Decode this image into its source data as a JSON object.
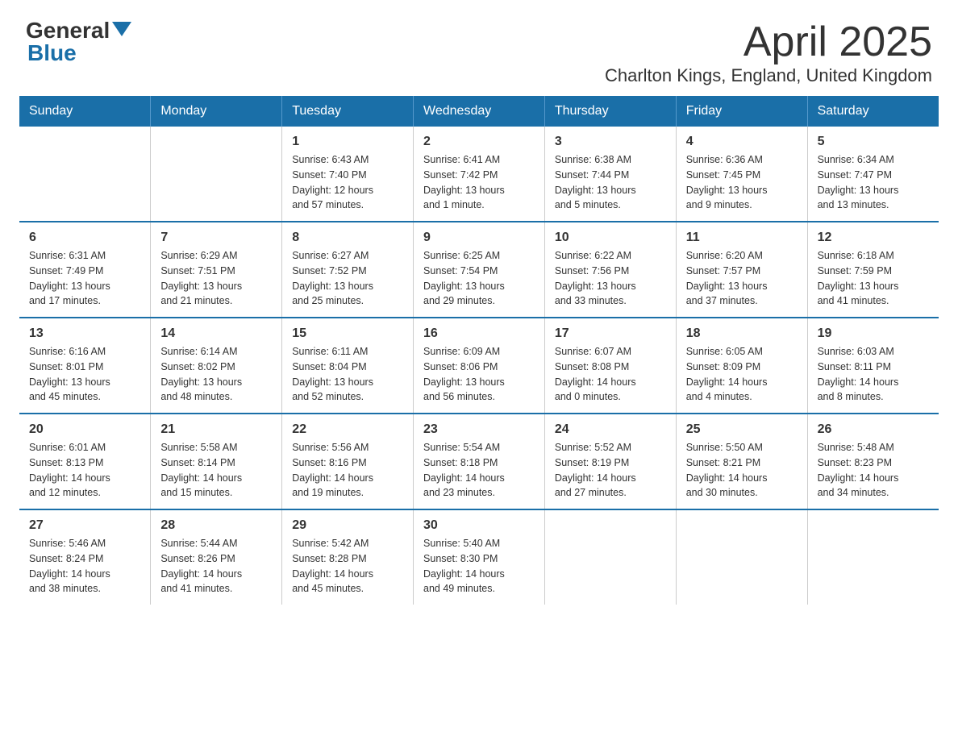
{
  "logo": {
    "general": "General",
    "blue": "Blue"
  },
  "header": {
    "month": "April 2025",
    "location": "Charlton Kings, England, United Kingdom"
  },
  "weekdays": [
    "Sunday",
    "Monday",
    "Tuesday",
    "Wednesday",
    "Thursday",
    "Friday",
    "Saturday"
  ],
  "weeks": [
    [
      {
        "day": "",
        "info": ""
      },
      {
        "day": "",
        "info": ""
      },
      {
        "day": "1",
        "info": "Sunrise: 6:43 AM\nSunset: 7:40 PM\nDaylight: 12 hours\nand 57 minutes."
      },
      {
        "day": "2",
        "info": "Sunrise: 6:41 AM\nSunset: 7:42 PM\nDaylight: 13 hours\nand 1 minute."
      },
      {
        "day": "3",
        "info": "Sunrise: 6:38 AM\nSunset: 7:44 PM\nDaylight: 13 hours\nand 5 minutes."
      },
      {
        "day": "4",
        "info": "Sunrise: 6:36 AM\nSunset: 7:45 PM\nDaylight: 13 hours\nand 9 minutes."
      },
      {
        "day": "5",
        "info": "Sunrise: 6:34 AM\nSunset: 7:47 PM\nDaylight: 13 hours\nand 13 minutes."
      }
    ],
    [
      {
        "day": "6",
        "info": "Sunrise: 6:31 AM\nSunset: 7:49 PM\nDaylight: 13 hours\nand 17 minutes."
      },
      {
        "day": "7",
        "info": "Sunrise: 6:29 AM\nSunset: 7:51 PM\nDaylight: 13 hours\nand 21 minutes."
      },
      {
        "day": "8",
        "info": "Sunrise: 6:27 AM\nSunset: 7:52 PM\nDaylight: 13 hours\nand 25 minutes."
      },
      {
        "day": "9",
        "info": "Sunrise: 6:25 AM\nSunset: 7:54 PM\nDaylight: 13 hours\nand 29 minutes."
      },
      {
        "day": "10",
        "info": "Sunrise: 6:22 AM\nSunset: 7:56 PM\nDaylight: 13 hours\nand 33 minutes."
      },
      {
        "day": "11",
        "info": "Sunrise: 6:20 AM\nSunset: 7:57 PM\nDaylight: 13 hours\nand 37 minutes."
      },
      {
        "day": "12",
        "info": "Sunrise: 6:18 AM\nSunset: 7:59 PM\nDaylight: 13 hours\nand 41 minutes."
      }
    ],
    [
      {
        "day": "13",
        "info": "Sunrise: 6:16 AM\nSunset: 8:01 PM\nDaylight: 13 hours\nand 45 minutes."
      },
      {
        "day": "14",
        "info": "Sunrise: 6:14 AM\nSunset: 8:02 PM\nDaylight: 13 hours\nand 48 minutes."
      },
      {
        "day": "15",
        "info": "Sunrise: 6:11 AM\nSunset: 8:04 PM\nDaylight: 13 hours\nand 52 minutes."
      },
      {
        "day": "16",
        "info": "Sunrise: 6:09 AM\nSunset: 8:06 PM\nDaylight: 13 hours\nand 56 minutes."
      },
      {
        "day": "17",
        "info": "Sunrise: 6:07 AM\nSunset: 8:08 PM\nDaylight: 14 hours\nand 0 minutes."
      },
      {
        "day": "18",
        "info": "Sunrise: 6:05 AM\nSunset: 8:09 PM\nDaylight: 14 hours\nand 4 minutes."
      },
      {
        "day": "19",
        "info": "Sunrise: 6:03 AM\nSunset: 8:11 PM\nDaylight: 14 hours\nand 8 minutes."
      }
    ],
    [
      {
        "day": "20",
        "info": "Sunrise: 6:01 AM\nSunset: 8:13 PM\nDaylight: 14 hours\nand 12 minutes."
      },
      {
        "day": "21",
        "info": "Sunrise: 5:58 AM\nSunset: 8:14 PM\nDaylight: 14 hours\nand 15 minutes."
      },
      {
        "day": "22",
        "info": "Sunrise: 5:56 AM\nSunset: 8:16 PM\nDaylight: 14 hours\nand 19 minutes."
      },
      {
        "day": "23",
        "info": "Sunrise: 5:54 AM\nSunset: 8:18 PM\nDaylight: 14 hours\nand 23 minutes."
      },
      {
        "day": "24",
        "info": "Sunrise: 5:52 AM\nSunset: 8:19 PM\nDaylight: 14 hours\nand 27 minutes."
      },
      {
        "day": "25",
        "info": "Sunrise: 5:50 AM\nSunset: 8:21 PM\nDaylight: 14 hours\nand 30 minutes."
      },
      {
        "day": "26",
        "info": "Sunrise: 5:48 AM\nSunset: 8:23 PM\nDaylight: 14 hours\nand 34 minutes."
      }
    ],
    [
      {
        "day": "27",
        "info": "Sunrise: 5:46 AM\nSunset: 8:24 PM\nDaylight: 14 hours\nand 38 minutes."
      },
      {
        "day": "28",
        "info": "Sunrise: 5:44 AM\nSunset: 8:26 PM\nDaylight: 14 hours\nand 41 minutes."
      },
      {
        "day": "29",
        "info": "Sunrise: 5:42 AM\nSunset: 8:28 PM\nDaylight: 14 hours\nand 45 minutes."
      },
      {
        "day": "30",
        "info": "Sunrise: 5:40 AM\nSunset: 8:30 PM\nDaylight: 14 hours\nand 49 minutes."
      },
      {
        "day": "",
        "info": ""
      },
      {
        "day": "",
        "info": ""
      },
      {
        "day": "",
        "info": ""
      }
    ]
  ]
}
